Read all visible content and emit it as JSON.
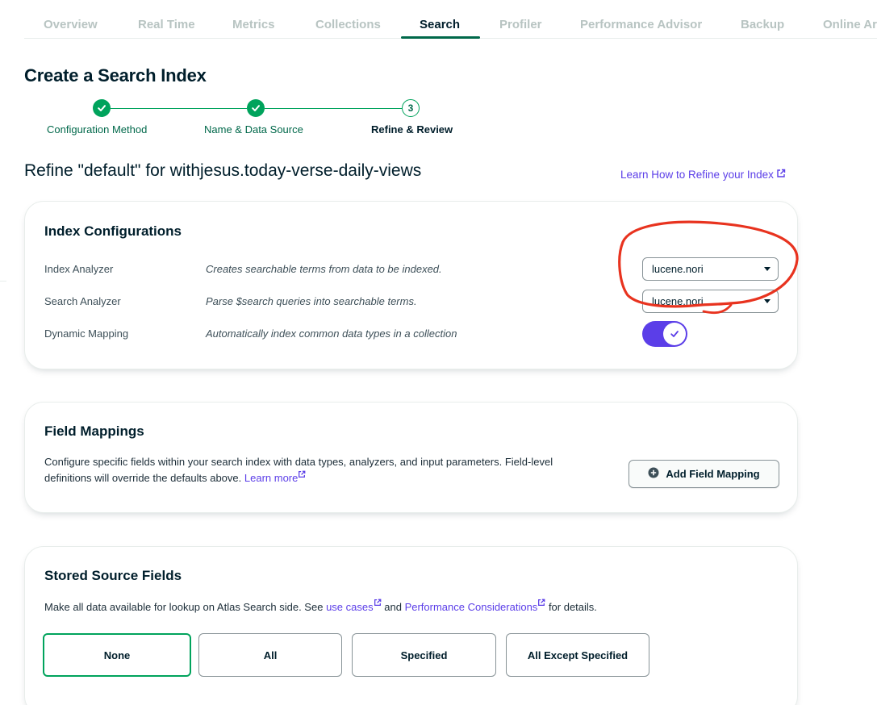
{
  "tabs": [
    {
      "label": "Overview"
    },
    {
      "label": "Real Time"
    },
    {
      "label": "Metrics"
    },
    {
      "label": "Collections"
    },
    {
      "label": "Search"
    },
    {
      "label": "Profiler"
    },
    {
      "label": "Performance Advisor"
    },
    {
      "label": "Backup"
    },
    {
      "label": "Online Ar"
    }
  ],
  "active_tab": "Search",
  "page_title": "Create a Search Index",
  "stepper": {
    "steps": [
      {
        "label": "Configuration Method",
        "status": "done"
      },
      {
        "label": "Name & Data Source",
        "status": "done"
      },
      {
        "label": "Refine & Review",
        "status": "current",
        "number": "3"
      }
    ]
  },
  "refine_title": "Refine \"default\" for withjesus.today-verse-daily-views",
  "learn_link": "Learn How to Refine your Index",
  "index_config": {
    "title": "Index Configurations",
    "rows": [
      {
        "label": "Index Analyzer",
        "desc": "Creates searchable terms from data to be indexed.",
        "value": "lucene.nori"
      },
      {
        "label": "Search Analyzer",
        "desc": "Parse $search queries into searchable terms.",
        "value": "lucene.nori"
      },
      {
        "label": "Dynamic Mapping",
        "desc": "Automatically index common data types in a collection",
        "enabled": true
      }
    ]
  },
  "field_mappings": {
    "title": "Field Mappings",
    "desc": "Configure specific fields within your search index with data types, analyzers, and input parameters. Field-level definitions will override the defaults above.",
    "learn_more": "Learn more",
    "add_button": "Add Field Mapping"
  },
  "stored_source": {
    "title": "Stored Source Fields",
    "desc_prefix": "Make all data available for lookup on Atlas Search side. See",
    "use_cases": "use cases",
    "and": "and",
    "perf_link": "Performance Considerations",
    "desc_suffix": "for details.",
    "options": [
      "None",
      "All",
      "Specified",
      "All Except Specified"
    ],
    "selected": "None"
  },
  "colors": {
    "accent_green": "#00a35c",
    "dark_green": "#00684a",
    "link_purple": "#5b3ee8",
    "annotation_red": "#e8331f"
  }
}
